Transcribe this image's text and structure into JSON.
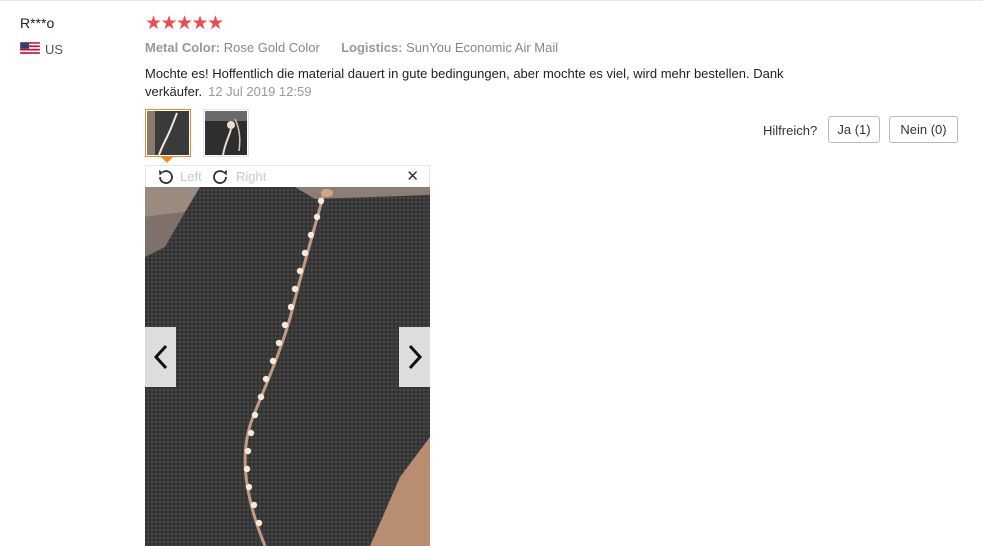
{
  "review": {
    "user_name": "R***o",
    "country": "US",
    "flag_icon": "us-flag-icon",
    "rating_stars": 5,
    "star_glyph": "★",
    "attributes": [
      {
        "key": "Metal Color:",
        "value": "Rose Gold Color"
      },
      {
        "key": "Logistics:",
        "value": "SunYou Economic Air Mail"
      }
    ],
    "text": "Mochte es! Hoffentlich die material dauert in gute bedingungen, aber mochte es viel, wird mehr bestellen. Dank verkäufer.",
    "date": "12 Jul 2019 12:59"
  },
  "viewer": {
    "rotate_left_label": "Left",
    "rotate_right_label": "Right",
    "close_glyph": "✕",
    "prev_icon": "chevron-left-icon",
    "next_icon": "chevron-right-icon"
  },
  "helpful": {
    "label": "Hilfreich?",
    "yes_label": "Ja (1)",
    "no_label": "Nein (0)"
  },
  "colors": {
    "star": "#ef4b4b",
    "active_thumb": "#f08a24"
  }
}
